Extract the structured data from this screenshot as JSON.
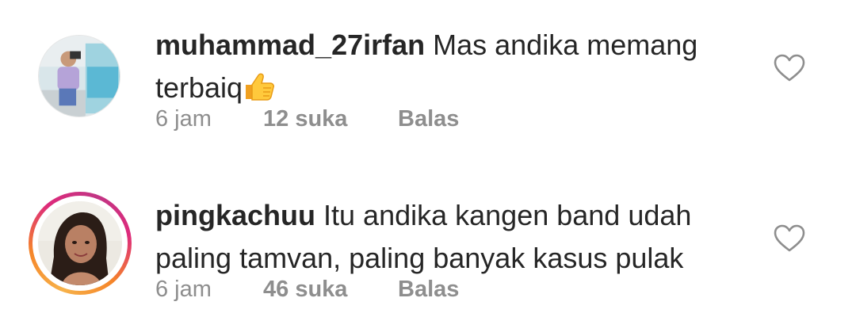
{
  "comments": [
    {
      "username": "muhammad_27irfan",
      "text": "Mas andika memang terbaiq",
      "emoji": "thumbs-up-emoji",
      "time": "6 jam",
      "likes": "12 suka",
      "reply": "Balas",
      "has_story_ring": false
    },
    {
      "username": "pingkachuu",
      "text": "Itu andika kangen band udah paling tamvan, paling banyak kasus pulak",
      "time": "6 jam",
      "likes": "46 suka",
      "reply": "Balas",
      "has_story_ring": true
    }
  ],
  "colors": {
    "text": "#262626",
    "meta": "#8e8e8e",
    "story_ring_start": "#f58529",
    "story_ring_end": "#dd2a7b"
  },
  "icons": {
    "like": "heart-outline-icon"
  }
}
